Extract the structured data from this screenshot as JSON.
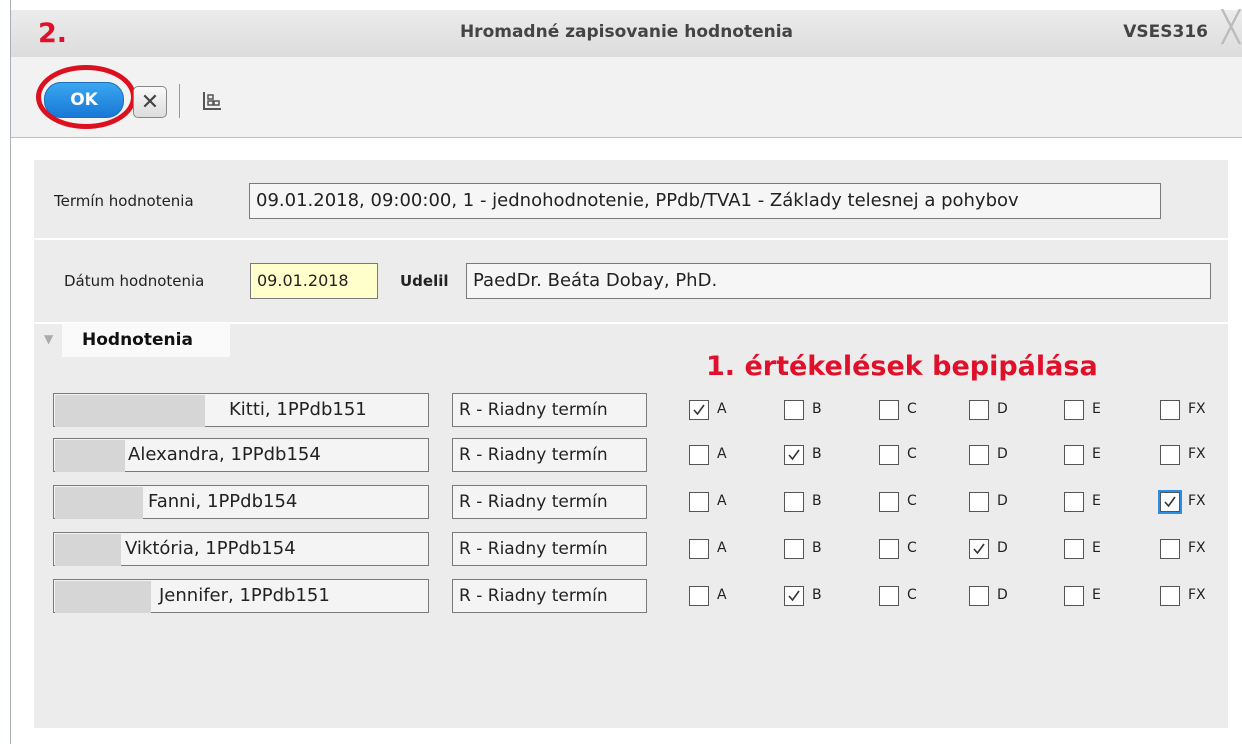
{
  "window": {
    "title": "Hromadné zapisovanie hodnotenia",
    "code": "VSES316",
    "close_glyph": "╳",
    "step_annotation": "2."
  },
  "toolbar": {
    "ok_label": "OK",
    "cancel_glyph": "✕",
    "grid_icon": "grid-tree-icon"
  },
  "form": {
    "termin_label": "Termín hodnotenia",
    "termin_value": "09.01.2018, 09:00:00, 1 - jednohodnotenie, PPdb/TVA1 - Základy telesnej a pohybov",
    "datum_label": "Dátum hodnotenia",
    "datum_value": "09.01.2018",
    "udelil_label": "Udelil",
    "udelil_value": "PaedDr. Beáta Dobay, PhD."
  },
  "section": {
    "title": "Hodnotenia",
    "toggle_glyph": "▼",
    "annotation": "1. értékelések bepipálása"
  },
  "grade_labels": [
    "A",
    "B",
    "C",
    "D",
    "E",
    "FX"
  ],
  "students": [
    {
      "name": "Kitti, 1PPdb151",
      "term": "R - Riadny termín",
      "grade": "A"
    },
    {
      "name": "Alexandra, 1PPdb154",
      "term": "R - Riadny termín",
      "grade": "B"
    },
    {
      "name": "Fanni, 1PPdb154",
      "term": "R - Riadny termín",
      "grade": "FX"
    },
    {
      "name": "Viktória, 1PPdb154",
      "term": "R - Riadny termín",
      "grade": "D"
    },
    {
      "name": "Jennifer, 1PPdb151",
      "term": "R - Riadny termín",
      "grade": "B"
    }
  ],
  "colors": {
    "annotation_red": "#e0102a",
    "ok_blue": "#1878d6",
    "date_field_bg": "#ffffcc",
    "focus_blue": "#2a8ee8"
  }
}
